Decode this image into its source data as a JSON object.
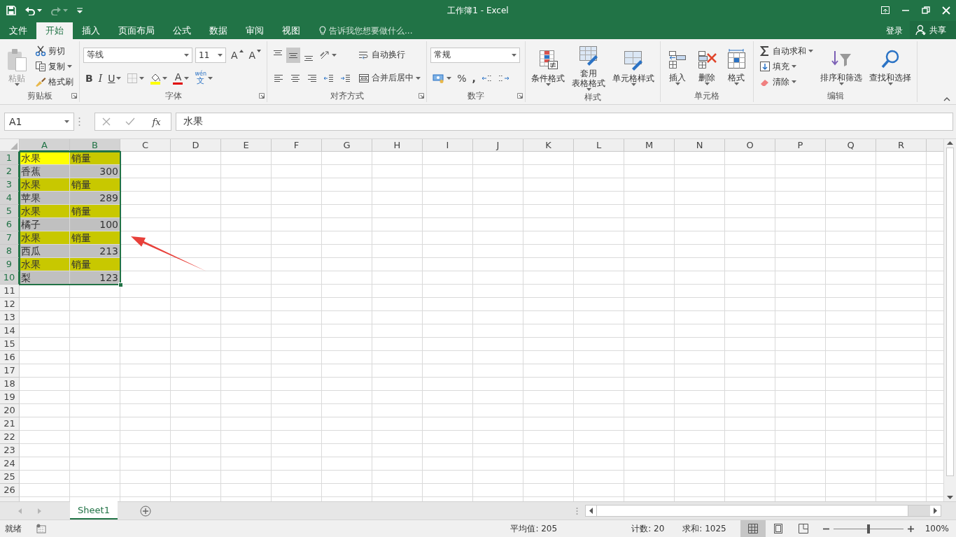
{
  "window": {
    "title": "工作簿1 - Excel"
  },
  "quick_access": [
    {
      "kind": "save",
      "dropdown": false,
      "disabled": false
    },
    {
      "kind": "undo",
      "dropdown": true,
      "disabled": false
    },
    {
      "kind": "redo",
      "dropdown": true,
      "disabled": true
    },
    {
      "kind": "customize",
      "dropdown": false,
      "disabled": false
    }
  ],
  "menu_tabs": [
    {
      "label": "文件",
      "selected": false
    },
    {
      "label": "开始",
      "selected": true
    },
    {
      "label": "插入",
      "selected": false
    },
    {
      "label": "页面布局",
      "selected": false
    },
    {
      "label": "公式",
      "selected": false
    },
    {
      "label": "数据",
      "selected": false
    },
    {
      "label": "审阅",
      "selected": false
    },
    {
      "label": "视图",
      "selected": false
    }
  ],
  "tell_me": {
    "placeholder": "告诉我您想要做什么..."
  },
  "account": {
    "sign_in": "登录",
    "share": "共享"
  },
  "ribbon": {
    "groups": [
      {
        "label": "剪贴板",
        "launcher": true,
        "columns": [
          [
            [
              {
                "kind": "large",
                "lines": [
                  "粘贴"
                ],
                "dropdown": true,
                "disabled": true
              }
            ]
          ],
          [
            [
              {
                "kind": "small",
                "label": "剪切",
                "dropdown": false
              }
            ],
            [
              {
                "kind": "small",
                "label": "复制",
                "dropdown": true
              }
            ],
            [
              {
                "kind": "small",
                "label": "格式刷",
                "dropdown": false
              }
            ]
          ]
        ]
      },
      {
        "label": "字体",
        "launcher": true,
        "columns": [
          [
            [
              {
                "kind": "font_combo",
                "value": "等线"
              },
              {
                "kind": "size_combo",
                "value": "11"
              },
              {
                "kind": "glyph",
                "glyph": "A",
                "dropdown": false
              },
              {
                "kind": "glyph",
                "glyph": "A",
                "dropdown": false
              }
            ],
            [
              {
                "kind": "bold",
                "glyph": "B",
                "dropdown": false
              },
              {
                "kind": "italic",
                "glyph": "I",
                "dropdown": false
              },
              {
                "kind": "underline",
                "glyph": "U",
                "dropdown": true
              },
              {
                "kind": "icon",
                "dropdown": true
              },
              {
                "kind": "icon",
                "dropdown": true
              },
              {
                "kind": "glyph",
                "glyph": "A",
                "dropdown": true
              },
              {
                "kind": "glyph",
                "glyph": "文",
                "ruby": "wén",
                "dropdown": true
              }
            ]
          ]
        ]
      },
      {
        "label": "对齐方式",
        "launcher": true,
        "columns": [
          [
            [
              {
                "kind": "icon",
                "dropdown": false,
                "selected": false
              },
              {
                "kind": "icon",
                "dropdown": false,
                "selected": true
              },
              {
                "kind": "icon",
                "dropdown": false,
                "selected": false
              },
              {
                "kind": "icon",
                "dropdown": true,
                "selected": false
              }
            ],
            [
              {
                "kind": "icon",
                "dropdown": false,
                "selected": false
              },
              {
                "kind": "icon",
                "dropdown": false,
                "selected": false
              },
              {
                "kind": "icon",
                "dropdown": false,
                "selected": false
              },
              {
                "kind": "icon",
                "dropdown": false,
                "selected": false
              },
              {
                "kind": "icon",
                "dropdown": false,
                "selected": false
              }
            ]
          ],
          [
            [
              {
                "kind": "small",
                "label": "自动换行",
                "dropdown": false
              }
            ],
            [
              {
                "kind": "small",
                "label": "合并后居中",
                "dropdown": true
              }
            ]
          ]
        ]
      },
      {
        "label": "数字",
        "launcher": true,
        "columns": [
          [
            [
              {
                "kind": "format_combo",
                "value": "常规"
              }
            ],
            [
              {
                "kind": "icon",
                "dropdown": true
              },
              {
                "kind": "glyph",
                "glyph": "%",
                "dropdown": false
              },
              {
                "kind": "bold",
                "glyph": ",",
                "dropdown": false
              },
              {
                "kind": "icon",
                "dropdown": false
              },
              {
                "kind": "icon",
                "dropdown": false
              }
            ]
          ]
        ]
      },
      {
        "label": "样式",
        "launcher": false,
        "columns": [
          [
            [
              {
                "kind": "large",
                "lines": [
                  "条件格式"
                ],
                "dropdown": true
              }
            ]
          ],
          [
            [
              {
                "kind": "large",
                "lines": [
                  "套用",
                  "表格格式"
                ],
                "dropdown": true
              }
            ]
          ],
          [
            [
              {
                "kind": "large",
                "lines": [
                  "单元格样式"
                ],
                "dropdown": true
              }
            ]
          ]
        ]
      },
      {
        "label": "单元格",
        "launcher": false,
        "columns": [
          [
            [
              {
                "kind": "large",
                "lines": [
                  "插入"
                ],
                "dropdown": true
              }
            ]
          ],
          [
            [
              {
                "kind": "large",
                "lines": [
                  "删除"
                ],
                "dropdown": true
              }
            ]
          ],
          [
            [
              {
                "kind": "large",
                "lines": [
                  "格式"
                ],
                "dropdown": true
              }
            ]
          ]
        ]
      },
      {
        "label": "编辑",
        "launcher": false,
        "columns": [
          [
            [
              {
                "kind": "small",
                "label": "自动求和",
                "dropdown": true
              }
            ],
            [
              {
                "kind": "small",
                "label": "填充",
                "dropdown": true
              }
            ],
            [
              {
                "kind": "small",
                "label": "清除",
                "dropdown": true
              }
            ]
          ],
          [
            [
              {
                "kind": "large",
                "lines": [
                  "排序和筛选"
                ],
                "dropdown": true
              }
            ]
          ],
          [
            [
              {
                "kind": "large",
                "lines": [
                  "查找和选择"
                ],
                "dropdown": true
              }
            ]
          ]
        ]
      }
    ]
  },
  "formula_bar": {
    "name_box": "A1",
    "function_label": "fx",
    "value": "水果"
  },
  "sheet": {
    "columns": [
      "A",
      "B",
      "C",
      "D",
      "E",
      "F",
      "G",
      "H",
      "I",
      "J",
      "K",
      "L",
      "M",
      "N",
      "O",
      "P",
      "Q",
      "R"
    ],
    "rows": [
      {
        "label": "1",
        "cells": [
          {
            "text": "水果",
            "kind": "text",
            "color": "#ffff00",
            "selected": true
          },
          {
            "text": "销量",
            "kind": "text",
            "color": "#c8c800",
            "selected": true
          }
        ]
      },
      {
        "label": "2",
        "cells": [
          {
            "text": "香蕉",
            "kind": "text",
            "color": "#c0c0c0",
            "selected": true
          },
          {
            "text": "300",
            "kind": "number",
            "color": "#c0c0c0",
            "selected": true
          }
        ]
      },
      {
        "label": "3",
        "cells": [
          {
            "text": "水果",
            "kind": "text",
            "color": "#c8c800",
            "selected": true
          },
          {
            "text": "销量",
            "kind": "text",
            "color": "#c8c800",
            "selected": true
          }
        ]
      },
      {
        "label": "4",
        "cells": [
          {
            "text": "苹果",
            "kind": "text",
            "color": "#c0c0c0",
            "selected": true
          },
          {
            "text": "289",
            "kind": "number",
            "color": "#c0c0c0",
            "selected": true
          }
        ]
      },
      {
        "label": "5",
        "cells": [
          {
            "text": "水果",
            "kind": "text",
            "color": "#c8c800",
            "selected": true
          },
          {
            "text": "销量",
            "kind": "text",
            "color": "#c8c800",
            "selected": true
          }
        ]
      },
      {
        "label": "6",
        "cells": [
          {
            "text": "橘子",
            "kind": "text",
            "color": "#c0c0c0",
            "selected": true
          },
          {
            "text": "100",
            "kind": "number",
            "color": "#c0c0c0",
            "selected": true
          }
        ]
      },
      {
        "label": "7",
        "cells": [
          {
            "text": "水果",
            "kind": "text",
            "color": "#c8c800",
            "selected": true
          },
          {
            "text": "销量",
            "kind": "text",
            "color": "#c8c800",
            "selected": true
          }
        ]
      },
      {
        "label": "8",
        "cells": [
          {
            "text": "西瓜",
            "kind": "text",
            "color": "#c0c0c0",
            "selected": true
          },
          {
            "text": "213",
            "kind": "number",
            "color": "#c0c0c0",
            "selected": true
          }
        ]
      },
      {
        "label": "9",
        "cells": [
          {
            "text": "水果",
            "kind": "text",
            "color": "#c8c800",
            "selected": true
          },
          {
            "text": "销量",
            "kind": "text",
            "color": "#c8c800",
            "selected": true
          }
        ]
      },
      {
        "label": "10",
        "cells": [
          {
            "text": "梨",
            "kind": "text",
            "color": "#c0c0c0",
            "selected": true
          },
          {
            "text": "123",
            "kind": "number",
            "color": "#c0c0c0",
            "selected": true
          }
        ]
      },
      {
        "label": "11"
      },
      {
        "label": "12"
      },
      {
        "label": "13"
      },
      {
        "label": "14"
      },
      {
        "label": "15"
      },
      {
        "label": "16"
      },
      {
        "label": "17"
      },
      {
        "label": "18"
      },
      {
        "label": "19"
      },
      {
        "label": "20"
      },
      {
        "label": "21"
      },
      {
        "label": "22"
      },
      {
        "label": "23"
      },
      {
        "label": "24"
      },
      {
        "label": "25"
      },
      {
        "label": "26"
      }
    ]
  },
  "annotation": {
    "kind": "arrow"
  },
  "sheet_tabs": [
    {
      "label": "Sheet1",
      "selected": true
    }
  ],
  "status_bar": {
    "mode": "就绪",
    "stats": [
      "平均值: 205",
      "计数: 20",
      "求和: 1025"
    ],
    "views": [
      {
        "kind": "normal",
        "selected": true
      },
      {
        "kind": "page_layout",
        "selected": false
      },
      {
        "kind": "page_break",
        "selected": false
      }
    ],
    "zoom": {
      "level": 0.5,
      "reading": "100%"
    }
  }
}
